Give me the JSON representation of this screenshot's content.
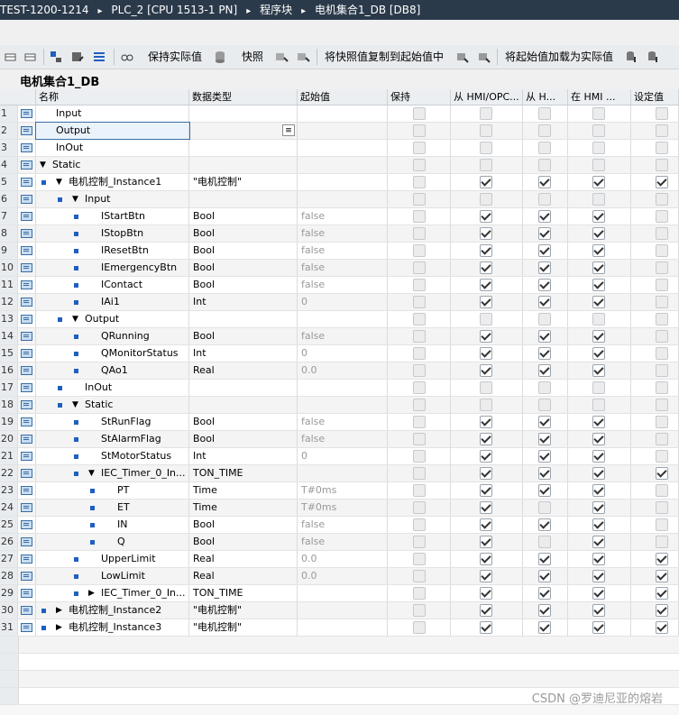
{
  "breadcrumb": [
    "TEST-1200-1214",
    "PLC_2 [CPU 1513-1 PN]",
    "程序块",
    "电机集合1_DB [DB8]"
  ],
  "toolbar": {
    "keep_actual": "保持实际值",
    "snapshot": "快照",
    "copy_snapshot": "将快照值复制到起始值中",
    "load_start": "将起始值加载为实际值"
  },
  "db_title": "电机集合1_DB",
  "headers": {
    "name": "名称",
    "type": "数据类型",
    "start": "起始值",
    "retain": "保持",
    "hmi_opc": "从 HMI/OPC...",
    "hmi_h": "从 H...",
    "in_hmi": "在 HMI ...",
    "setpoint": "设定值"
  },
  "rows": [
    {
      "n": "1",
      "name": "Input",
      "type": "",
      "start": "",
      "ret": "d",
      "c1": "d",
      "c2": "d",
      "c3": "d",
      "c4": "d"
    },
    {
      "n": "2",
      "name": "Output",
      "type": "",
      "start": "",
      "ret": "d",
      "c1": "d",
      "c2": "d",
      "c3": "d",
      "c4": "d"
    },
    {
      "n": "3",
      "name": "InOut",
      "type": "",
      "start": "",
      "ret": "d",
      "c1": "d",
      "c2": "d",
      "c3": "d",
      "c4": "d"
    },
    {
      "n": "4",
      "name": "Static",
      "type": "",
      "start": "",
      "ret": "d",
      "c1": "d",
      "c2": "d",
      "c3": "d",
      "c4": "d"
    },
    {
      "n": "5",
      "name": "电机控制_Instance1",
      "type": "\"电机控制\"",
      "start": "",
      "ret": "d",
      "c1": "on",
      "c2": "on",
      "c3": "on",
      "c4": "on"
    },
    {
      "n": "6",
      "name": "Input",
      "type": "",
      "start": "",
      "ret": "d",
      "c1": "d",
      "c2": "d",
      "c3": "d",
      "c4": "d"
    },
    {
      "n": "7",
      "name": "IStartBtn",
      "type": "Bool",
      "start": "false",
      "ret": "d",
      "c1": "on",
      "c2": "on",
      "c3": "on",
      "c4": "d"
    },
    {
      "n": "8",
      "name": "IStopBtn",
      "type": "Bool",
      "start": "false",
      "ret": "d",
      "c1": "on",
      "c2": "on",
      "c3": "on",
      "c4": "d"
    },
    {
      "n": "9",
      "name": "IResetBtn",
      "type": "Bool",
      "start": "false",
      "ret": "d",
      "c1": "on",
      "c2": "on",
      "c3": "on",
      "c4": "d"
    },
    {
      "n": "10",
      "name": "IEmergencyBtn",
      "type": "Bool",
      "start": "false",
      "ret": "d",
      "c1": "on",
      "c2": "on",
      "c3": "on",
      "c4": "d"
    },
    {
      "n": "11",
      "name": "IContact",
      "type": "Bool",
      "start": "false",
      "ret": "d",
      "c1": "on",
      "c2": "on",
      "c3": "on",
      "c4": "d"
    },
    {
      "n": "12",
      "name": "IAi1",
      "type": "Int",
      "start": "0",
      "ret": "d",
      "c1": "on",
      "c2": "on",
      "c3": "on",
      "c4": "d"
    },
    {
      "n": "13",
      "name": "Output",
      "type": "",
      "start": "",
      "ret": "d",
      "c1": "d",
      "c2": "d",
      "c3": "d",
      "c4": "d"
    },
    {
      "n": "14",
      "name": "QRunning",
      "type": "Bool",
      "start": "false",
      "ret": "d",
      "c1": "on",
      "c2": "on",
      "c3": "on",
      "c4": "d"
    },
    {
      "n": "15",
      "name": "QMonitorStatus",
      "type": "Int",
      "start": "0",
      "ret": "d",
      "c1": "on",
      "c2": "on",
      "c3": "on",
      "c4": "d"
    },
    {
      "n": "16",
      "name": "QAo1",
      "type": "Real",
      "start": "0.0",
      "ret": "d",
      "c1": "on",
      "c2": "on",
      "c3": "on",
      "c4": "d"
    },
    {
      "n": "17",
      "name": "InOut",
      "type": "",
      "start": "",
      "ret": "d",
      "c1": "d",
      "c2": "d",
      "c3": "d",
      "c4": "d"
    },
    {
      "n": "18",
      "name": "Static",
      "type": "",
      "start": "",
      "ret": "d",
      "c1": "d",
      "c2": "d",
      "c3": "d",
      "c4": "d"
    },
    {
      "n": "19",
      "name": "StRunFlag",
      "type": "Bool",
      "start": "false",
      "ret": "d",
      "c1": "on",
      "c2": "on",
      "c3": "on",
      "c4": "d"
    },
    {
      "n": "20",
      "name": "StAlarmFlag",
      "type": "Bool",
      "start": "false",
      "ret": "d",
      "c1": "on",
      "c2": "on",
      "c3": "on",
      "c4": "d"
    },
    {
      "n": "21",
      "name": "StMotorStatus",
      "type": "Int",
      "start": "0",
      "ret": "d",
      "c1": "on",
      "c2": "on",
      "c3": "on",
      "c4": "d"
    },
    {
      "n": "22",
      "name": "IEC_Timer_0_In...",
      "type": "TON_TIME",
      "start": "",
      "ret": "d",
      "c1": "on",
      "c2": "on",
      "c3": "on",
      "c4": "on"
    },
    {
      "n": "23",
      "name": "PT",
      "type": "Time",
      "start": "T#0ms",
      "ret": "d",
      "c1": "on",
      "c2": "on",
      "c3": "on",
      "c4": "d"
    },
    {
      "n": "24",
      "name": "ET",
      "type": "Time",
      "start": "T#0ms",
      "ret": "d",
      "c1": "on",
      "c2": "d",
      "c3": "on",
      "c4": "d"
    },
    {
      "n": "25",
      "name": "IN",
      "type": "Bool",
      "start": "false",
      "ret": "d",
      "c1": "on",
      "c2": "on",
      "c3": "on",
      "c4": "d"
    },
    {
      "n": "26",
      "name": "Q",
      "type": "Bool",
      "start": "false",
      "ret": "d",
      "c1": "on",
      "c2": "d",
      "c3": "on",
      "c4": "d"
    },
    {
      "n": "27",
      "name": "UpperLimit",
      "type": "Real",
      "start": "0.0",
      "ret": "d",
      "c1": "on",
      "c2": "on",
      "c3": "on",
      "c4": "on"
    },
    {
      "n": "28",
      "name": "LowLimit",
      "type": "Real",
      "start": "0.0",
      "ret": "d",
      "c1": "on",
      "c2": "on",
      "c3": "on",
      "c4": "on"
    },
    {
      "n": "29",
      "name": "IEC_Timer_0_In...",
      "type": "TON_TIME",
      "start": "",
      "ret": "d",
      "c1": "on",
      "c2": "on",
      "c3": "on",
      "c4": "on"
    },
    {
      "n": "30",
      "name": "电机控制_Instance2",
      "type": "\"电机控制\"",
      "start": "",
      "ret": "d",
      "c1": "on",
      "c2": "on",
      "c3": "on",
      "c4": "on"
    },
    {
      "n": "31",
      "name": "电机控制_Instance3",
      "type": "\"电机控制\"",
      "start": "",
      "ret": "d",
      "c1": "on",
      "c2": "on",
      "c3": "on",
      "c4": "on"
    }
  ],
  "watermark": "CSDN @罗迪尼亚的熔岩"
}
